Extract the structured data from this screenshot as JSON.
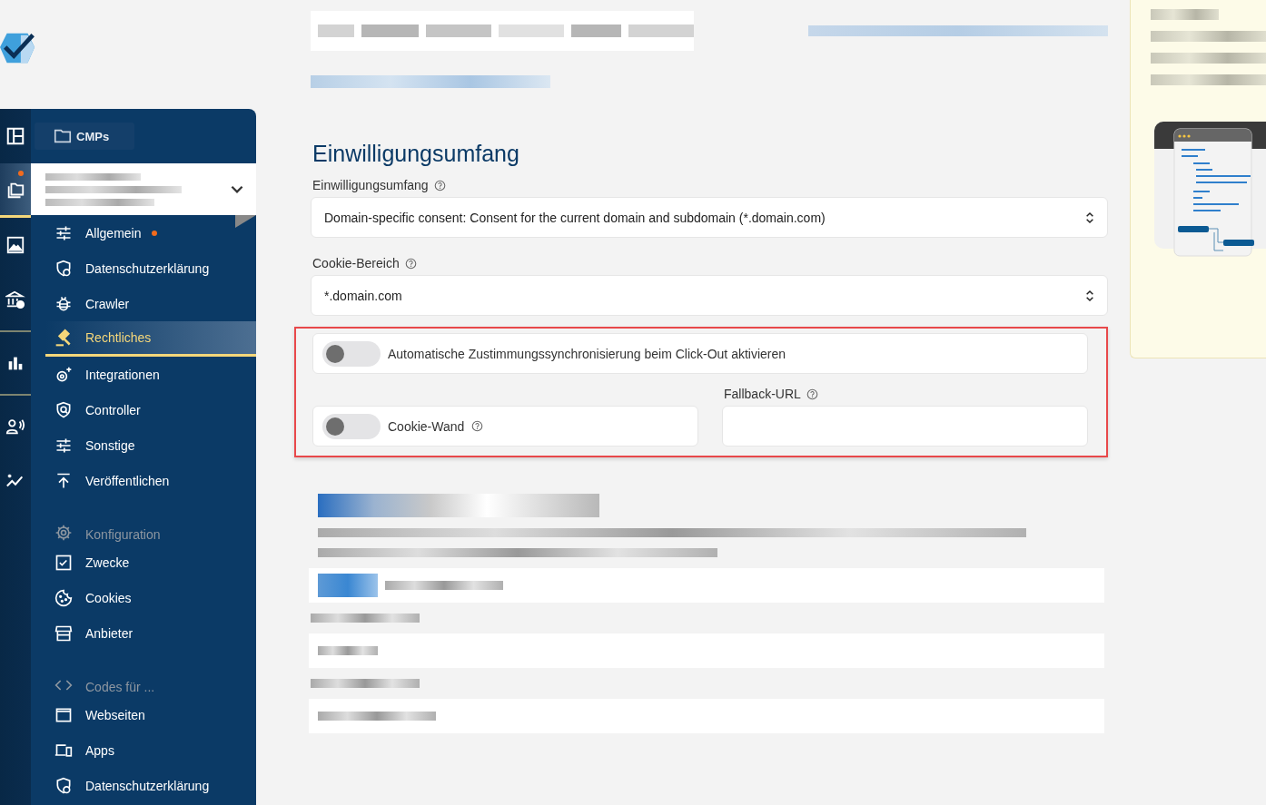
{
  "rail": [
    {
      "selected": false,
      "notification": false
    },
    {
      "selected": true,
      "notification": true
    },
    {
      "selected": false,
      "notification": false
    },
    {
      "selected": false,
      "notification": false
    },
    {
      "selected": false,
      "notification": false
    },
    {
      "selected": false,
      "notification": false
    },
    {
      "selected": false,
      "notification": false
    }
  ],
  "tooltip": "CMPs",
  "menu": [
    {
      "kind": "item",
      "label": "Allgemein",
      "selected": false,
      "notification": true
    },
    {
      "kind": "item",
      "label": "Datenschutzerklärung",
      "selected": false,
      "notification": false
    },
    {
      "kind": "item",
      "label": "Crawler",
      "selected": false,
      "notification": false
    },
    {
      "kind": "item",
      "label": "Rechtliches",
      "selected": true,
      "notification": false
    },
    {
      "kind": "item",
      "label": "Integrationen",
      "selected": false,
      "notification": false
    },
    {
      "kind": "item",
      "label": "Controller",
      "selected": false,
      "notification": false
    },
    {
      "kind": "item",
      "label": "Sonstige",
      "selected": false,
      "notification": false
    },
    {
      "kind": "item",
      "label": "Veröffentlichen",
      "selected": false,
      "notification": false
    },
    {
      "kind": "header",
      "label": "Konfiguration"
    },
    {
      "kind": "item",
      "label": "Zwecke",
      "selected": false,
      "notification": false
    },
    {
      "kind": "item",
      "label": "Cookies",
      "selected": false,
      "notification": false
    },
    {
      "kind": "item",
      "label": "Anbieter",
      "selected": false,
      "notification": false
    },
    {
      "kind": "header",
      "label": "Codes für ..."
    },
    {
      "kind": "item",
      "label": "Webseiten",
      "selected": false,
      "notification": false
    },
    {
      "kind": "item",
      "label": "Apps",
      "selected": false,
      "notification": false
    },
    {
      "kind": "item",
      "label": "Datenschutzerklärung",
      "selected": false,
      "notification": false
    }
  ],
  "section": {
    "title": "Einwilligungsumfang",
    "consent_scope": {
      "label": "Einwilligungsumfang",
      "value": "Domain-specific consent: Consent for the current domain and subdomain (*.domain.com)"
    },
    "cookie_scope": {
      "label": "Cookie-Bereich",
      "value": "*.domain.com"
    },
    "click_out_sync": {
      "label": "Automatische Zustimmungssynchronisierung beim Click-Out aktivieren",
      "on": false
    },
    "cookie_wall": {
      "label": "Cookie-Wand",
      "on": false
    },
    "fallback_url": {
      "label": "Fallback-URL"
    }
  }
}
